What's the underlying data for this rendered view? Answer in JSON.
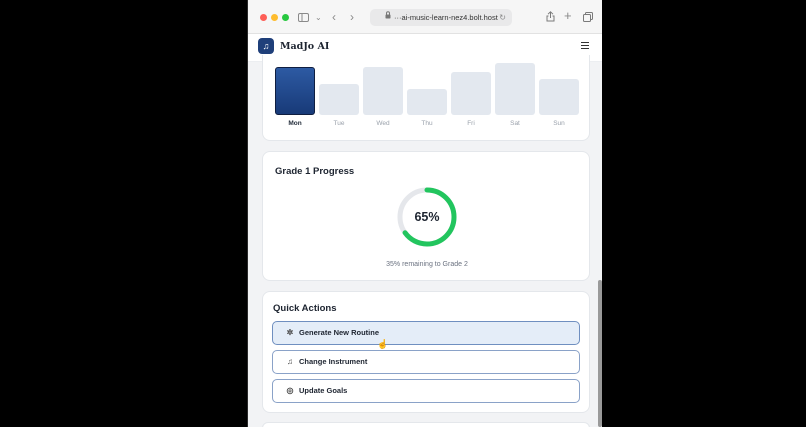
{
  "browser": {
    "url": "···ai-music-learn-nez4.bolt.host"
  },
  "app": {
    "name": "MadJo AI",
    "brand_color": "#1f3f7a"
  },
  "weekly": {
    "days": [
      {
        "label": "Mon",
        "level": 0.92,
        "active": true
      },
      {
        "label": "Tue",
        "level": 0.6,
        "active": false
      },
      {
        "label": "Wed",
        "level": 0.92,
        "active": false
      },
      {
        "label": "Thu",
        "level": 0.5,
        "active": false
      },
      {
        "label": "Fri",
        "level": 0.82,
        "active": false
      },
      {
        "label": "Sat",
        "level": 1.0,
        "active": false
      },
      {
        "label": "Sun",
        "level": 0.7,
        "active": false
      }
    ]
  },
  "progress": {
    "title": "Grade 1 Progress",
    "percent": 65,
    "percent_label": "65%",
    "remaining_text": "35% remaining to Grade 2",
    "ring_color": "#22c55e",
    "track_color": "#e5e7eb"
  },
  "quick_actions": {
    "title": "Quick Actions",
    "items": [
      {
        "label": "Generate New Routine",
        "icon": "sparkles-icon"
      },
      {
        "label": "Change Instrument",
        "icon": "music-note-icon"
      },
      {
        "label": "Update Goals",
        "icon": "target-icon"
      }
    ]
  }
}
